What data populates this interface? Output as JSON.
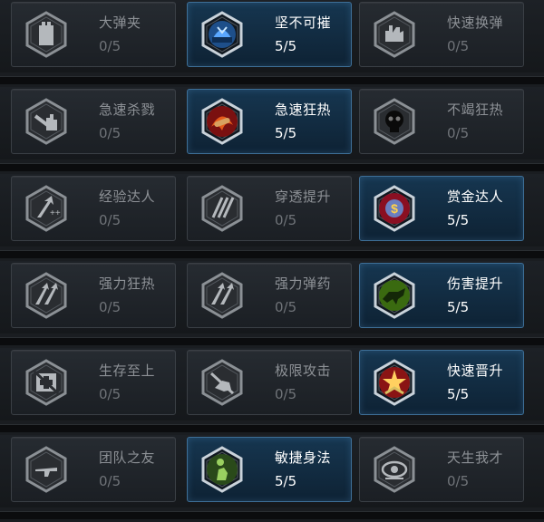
{
  "rows": [
    {
      "cards": [
        {
          "name": "大弹夹",
          "count": "0/5",
          "active": false,
          "icon": "ammo-magazine-icon"
        },
        {
          "name": "坚不可摧",
          "count": "5/5",
          "active": true,
          "icon": "helmet-icon"
        },
        {
          "name": "快速换弹",
          "count": "0/5",
          "active": false,
          "icon": "hand-reload-icon"
        }
      ]
    },
    {
      "cards": [
        {
          "name": "急速杀戮",
          "count": "0/5",
          "active": false,
          "icon": "knife-hand-icon"
        },
        {
          "name": "急速狂热",
          "count": "5/5",
          "active": true,
          "icon": "fire-bullet-icon"
        },
        {
          "name": "不竭狂热",
          "count": "0/5",
          "active": false,
          "icon": "skull-icon"
        }
      ]
    },
    {
      "cards": [
        {
          "name": "经验达人",
          "count": "0/5",
          "active": false,
          "icon": "xp-arrow-icon"
        },
        {
          "name": "穿透提升",
          "count": "0/5",
          "active": false,
          "icon": "penetration-icon"
        },
        {
          "name": "赏金达人",
          "count": "5/5",
          "active": true,
          "icon": "bounty-dollar-icon"
        }
      ]
    },
    {
      "cards": [
        {
          "name": "强力狂热",
          "count": "0/5",
          "active": false,
          "icon": "power-arrows-icon"
        },
        {
          "name": "强力弹药",
          "count": "0/5",
          "active": false,
          "icon": "power-ammo-icon"
        },
        {
          "name": "伤害提升",
          "count": "5/5",
          "active": true,
          "icon": "damage-beast-icon"
        }
      ]
    },
    {
      "cards": [
        {
          "name": "生存至上",
          "count": "0/5",
          "active": false,
          "icon": "medkit-icon"
        },
        {
          "name": "极限攻击",
          "count": "0/5",
          "active": false,
          "icon": "extreme-attack-icon"
        },
        {
          "name": "快速晋升",
          "count": "5/5",
          "active": true,
          "icon": "rank-burst-icon"
        }
      ]
    },
    {
      "cards": [
        {
          "name": "团队之友",
          "count": "0/5",
          "active": false,
          "icon": "team-rifle-icon"
        },
        {
          "name": "敏捷身法",
          "count": "5/5",
          "active": true,
          "icon": "agile-soldier-icon"
        },
        {
          "name": "天生我才",
          "count": "0/5",
          "active": false,
          "icon": "eye-talent-icon"
        }
      ]
    }
  ]
}
